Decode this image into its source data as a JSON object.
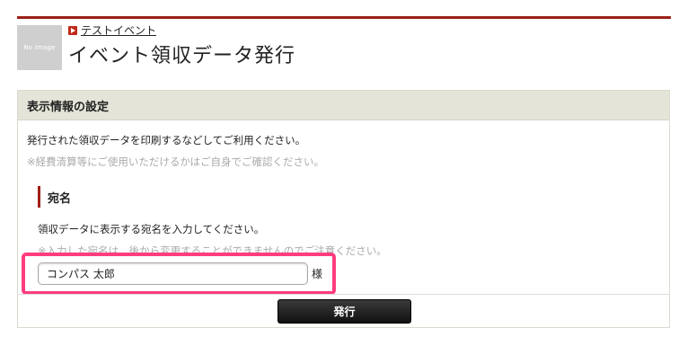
{
  "header": {
    "thumbnail_text": "No Image",
    "event_link": "テストイベント",
    "page_title": "イベント領収データ発行"
  },
  "panel": {
    "title": "表示情報の設定",
    "intro": "発行された領収データを印刷するなどしてご利用ください。",
    "note": "※経費清算等にご使用いただけるかはご自身でご確認ください。"
  },
  "addressee": {
    "title": "宛名",
    "description": "領収データに表示する宛名を入力してください。",
    "note": "※入力した宛名は、後から変更することができませんのでご注意ください。",
    "input_value": "コンパス 太郎",
    "suffix": "様"
  },
  "actions": {
    "issue_label": "発行"
  },
  "colors": {
    "accent_red": "#9b2115",
    "highlight_pink": "#ff3d7e",
    "panel_header_bg": "#e4e4d8"
  },
  "icons": {
    "event_link_icon": "play-square-icon"
  }
}
